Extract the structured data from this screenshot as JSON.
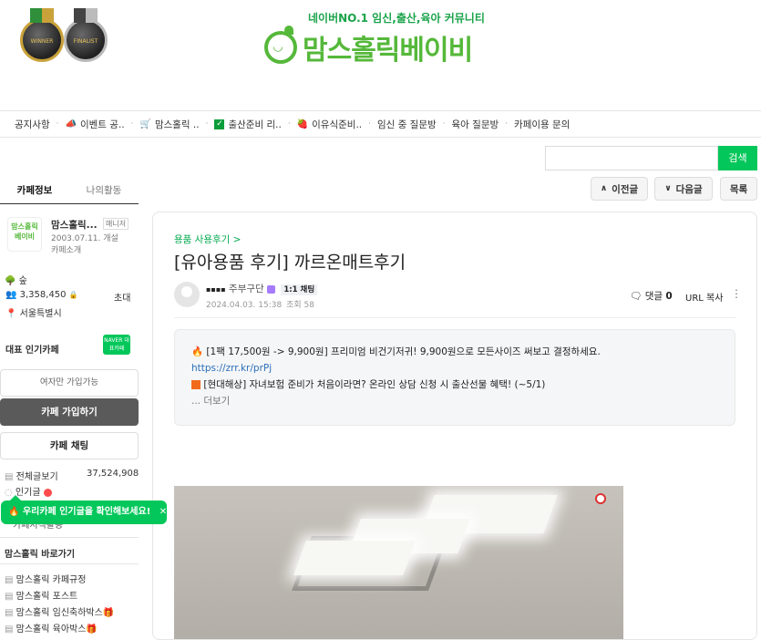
{
  "header": {
    "badges": [
      {
        "label": "WINNER"
      },
      {
        "label": "FINALIST"
      }
    ],
    "tagline": "네이버NO.1 임신,출산,육아 커뮤니티",
    "logo_text": "맘스홀릭베이비",
    "colors": {
      "brand_green": "#55b83a",
      "naver_green": "#03c75a"
    }
  },
  "menu": [
    {
      "label": "공지사항",
      "icon": ""
    },
    {
      "label": "이벤트 공..",
      "icon": "megaphone-icon"
    },
    {
      "label": "맘스홀릭 ..",
      "icon": "cart-icon"
    },
    {
      "label": "출산준비 리..",
      "icon": "checkbox-icon"
    },
    {
      "label": "이유식준비..",
      "icon": "strawberry-icon"
    },
    {
      "label": "임신 중 질문방",
      "icon": ""
    },
    {
      "label": "육아 질문방",
      "icon": ""
    },
    {
      "label": "카페이용 문의",
      "icon": ""
    }
  ],
  "search": {
    "button": "검색",
    "placeholder": ""
  },
  "nav": {
    "prev": "이전글",
    "next": "다음글",
    "list": "목록"
  },
  "sidebar": {
    "tabs": [
      "카페정보",
      "나의활동"
    ],
    "cafe_logo": "맘스홀릭 베이비",
    "cafe_name": "맘스홀릭...",
    "manager": "매니저",
    "since": "2003.07.11. 개설",
    "intro": "카페소개",
    "level": "숲",
    "members": "3,358,450",
    "invite": "초대",
    "location": "서울특별시",
    "popular_label": "대표 인기카페",
    "naver_badge": "NAVER 대표카페",
    "female_only": "여자만 가입가능",
    "join": "카페 가입하기",
    "chat": "카페 채팅",
    "all_posts": "전체글보기",
    "all_posts_count": "37,524,908",
    "popular_posts": "인기글",
    "toast": "우리카페 인기글을 확인해보세요!",
    "shortcut_title": "맘스홀릭 바로가기",
    "shortcuts": [
      "맘스홀릭 카페규정",
      "맘스홀릭 포스트",
      "맘스홀릭 임신축하박스🎁",
      "맘스홀릭 육아박스🎁"
    ],
    "hidden_item": "카페지식활동"
  },
  "post": {
    "board": "용품 사용후기 >",
    "title": "[유아용품 후기] 까르온매트후기",
    "author": "주부구단",
    "chat": "1:1 채팅",
    "date": "2024.04.03. 15:38",
    "views": "조회 58",
    "comments_label": "댓글",
    "comments_count": "0",
    "url_copy": "URL 복사",
    "notice": {
      "line1": "[1팩 17,500원 -> 9,900원] 프리미엄 비건기저귀! 9,900원으로 모든사이즈 써보고 결정하세요.",
      "link": "https://zrr.kr/prPj",
      "line2": "[현대해상] 자녀보험 준비가 처음이라면? 온라인 상담 신청 시 출산선물 혜택! (~5/1)",
      "more": "... 더보기"
    }
  }
}
